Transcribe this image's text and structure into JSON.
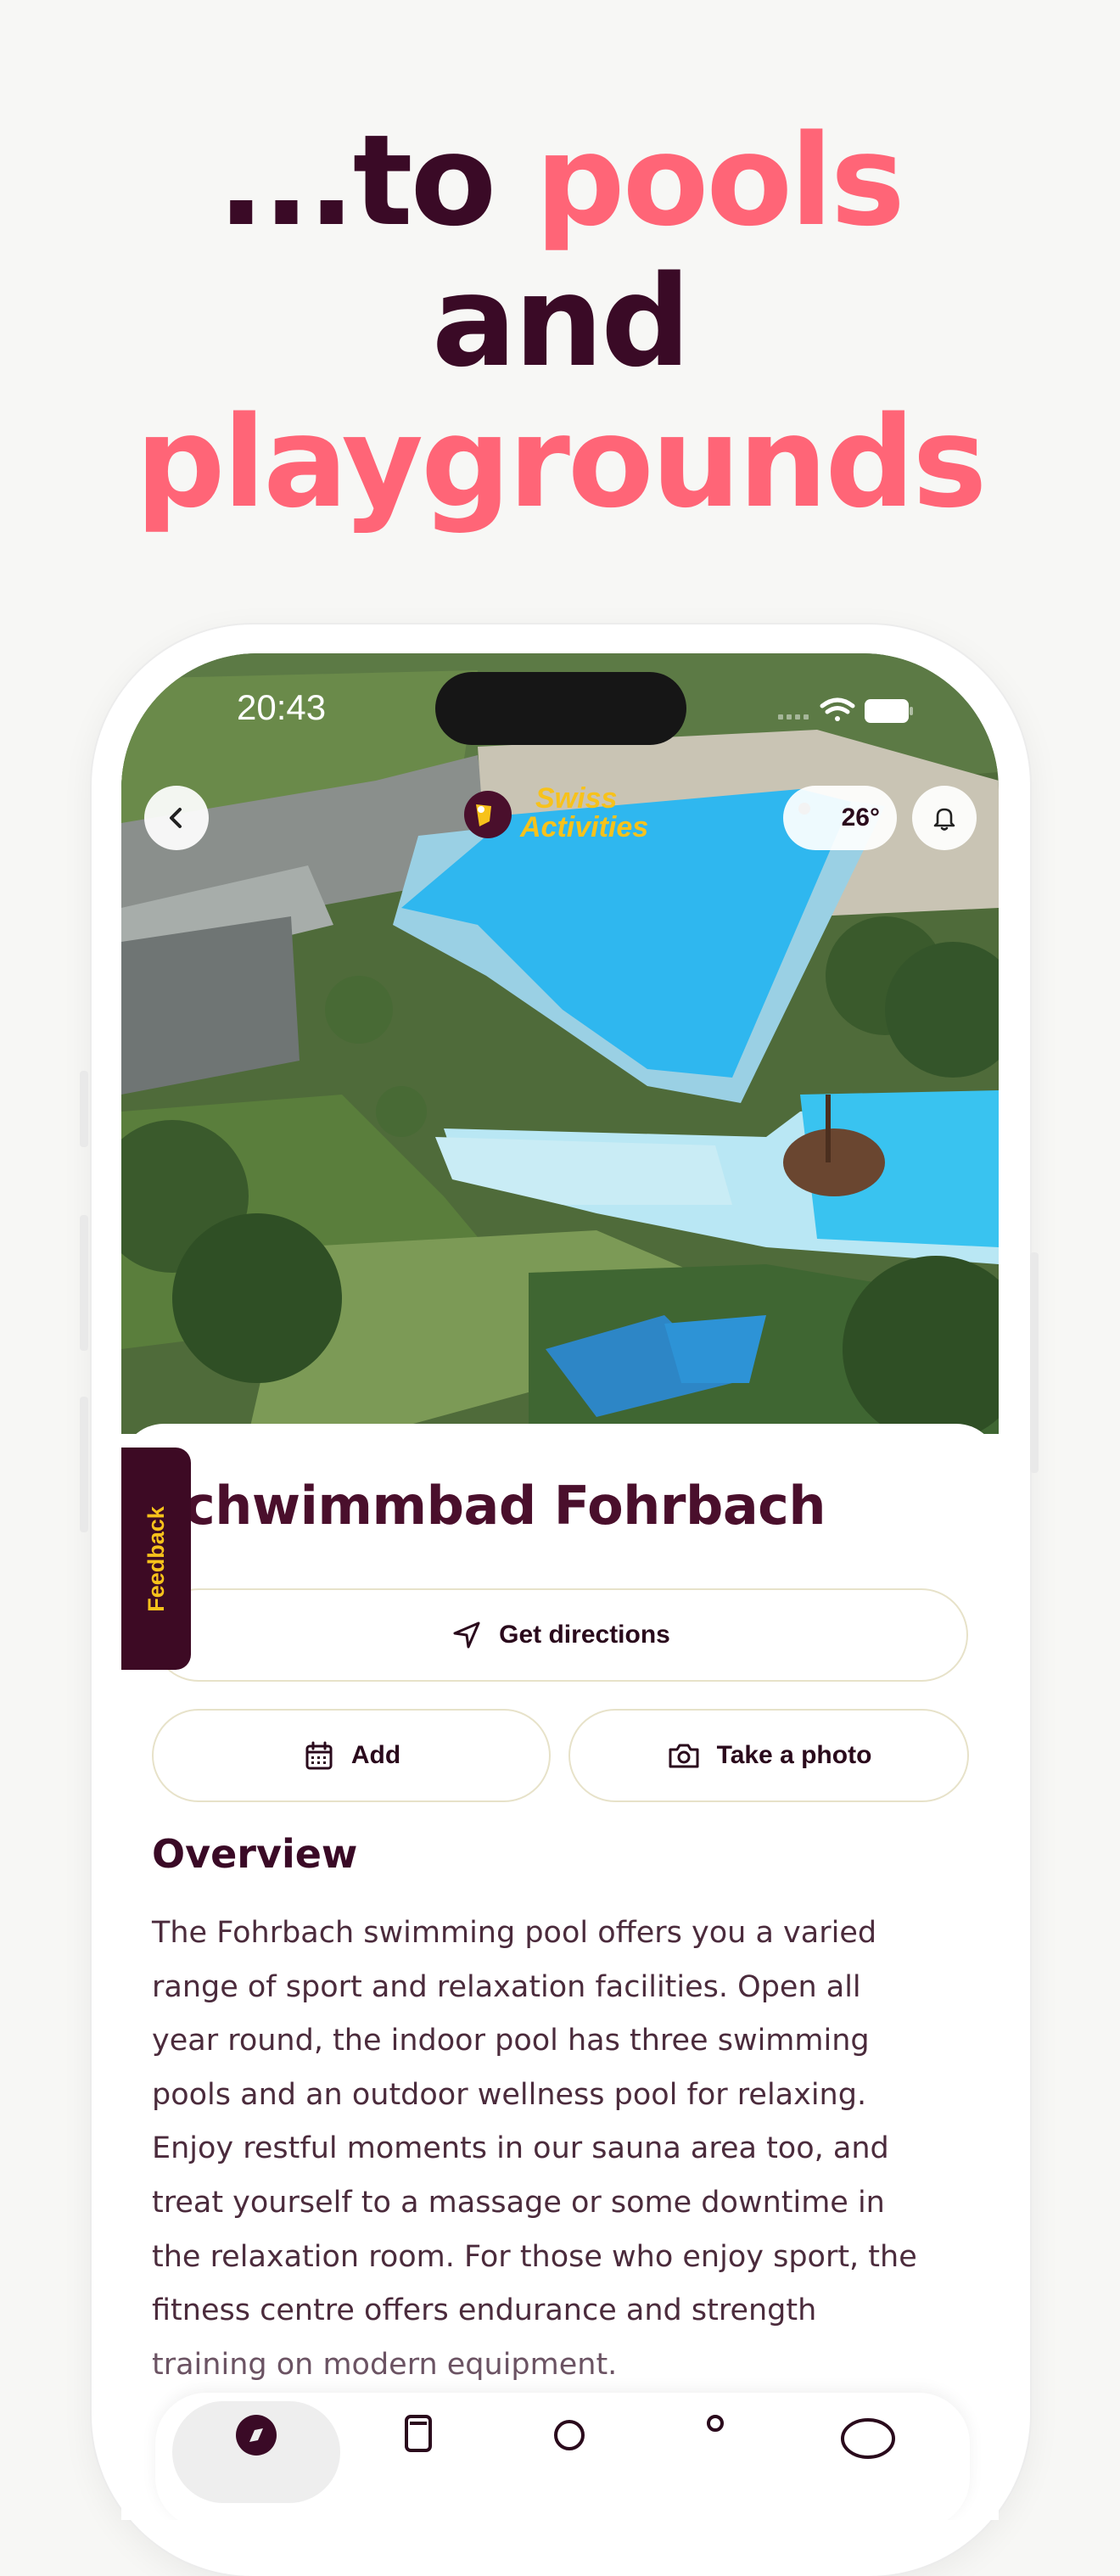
{
  "headline": {
    "line1_dark": "...to ",
    "line1_pink": "pools",
    "line2": "and",
    "line3": "playgrounds"
  },
  "status_bar": {
    "time": "20:43"
  },
  "header": {
    "logo_line1": "Swiss",
    "logo_line2": "Activities",
    "temperature": "26°"
  },
  "place": {
    "title": "chwimmbad Fohrbach"
  },
  "actions": {
    "directions": "Get directions",
    "add": "Add",
    "photo": "Take a photo"
  },
  "feedback": {
    "label": "Feedback"
  },
  "overview": {
    "title": "Overview",
    "lines": [
      "The Fohrbach swimming pool offers you a varied",
      "range of sport and relaxation facilities. Open all",
      "year round, the indoor pool has three swimming",
      "pools and an outdoor wellness pool for relaxing.",
      "Enjoy restful moments in our sauna area too, and",
      "treat yourself to a massage or some downtime in",
      "the relaxation room. For those who enjoy sport, the",
      "fitness centre offers endurance and strength",
      "training on modern equipment."
    ]
  },
  "colors": {
    "brand_dark": "#3a0a26",
    "brand_pink": "#ff6577",
    "brand_yellow": "#f7c21b",
    "pill_border": "#e7e2c9"
  },
  "icons": [
    "back-chevron-icon",
    "bell-icon",
    "navigation-arrow-icon",
    "calendar-icon",
    "camera-icon",
    "wifi-icon",
    "battery-icon"
  ]
}
